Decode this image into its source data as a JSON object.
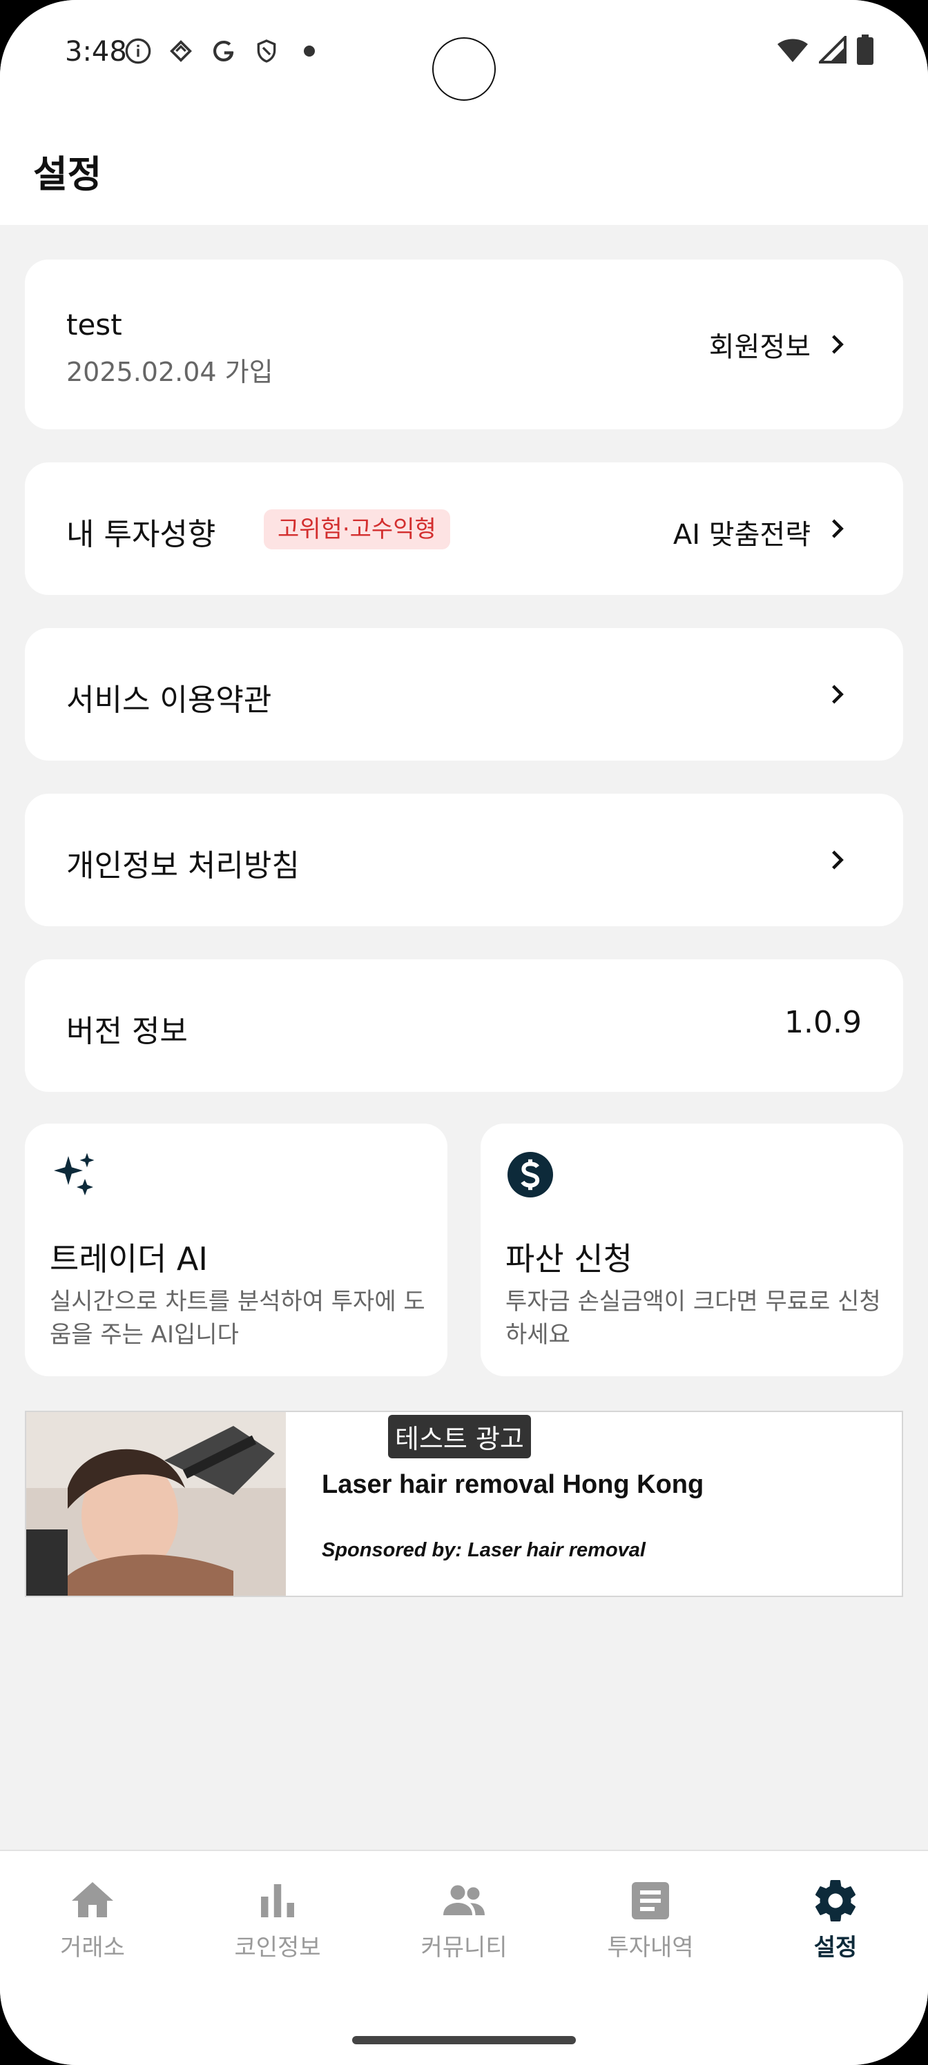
{
  "status_bar": {
    "time": "3:48",
    "left_icons": [
      "info-icon",
      "diamond-icon",
      "google-icon",
      "shield-icon",
      "dot-icon"
    ],
    "right_icons": [
      "wifi-icon",
      "signal-icon",
      "battery-icon"
    ]
  },
  "header": {
    "title": "설정"
  },
  "user": {
    "name": "test",
    "joined": "2025.02.04 가입",
    "member_info_label": "회원정보"
  },
  "investment": {
    "label": "내 투자성향",
    "badge": "고위험·고수익형",
    "ai_strategy_label": "AI 맞춤전략"
  },
  "menu": {
    "terms": "서비스 이용약관",
    "privacy": "개인정보 처리방침",
    "version_label": "버전 정보",
    "version_value": "1.0.9"
  },
  "features": [
    {
      "icon": "sparkles-icon",
      "title": "트레이더 AI",
      "description": "실시간으로 차트를 분석하여 투자에 도움을 주는 AI입니다"
    },
    {
      "icon": "dollar-circle-icon",
      "title": "파산 신청",
      "description": "투자금 손실금액이 크다면 무료로 신청하세요"
    }
  ],
  "ad": {
    "label": "테스트 광고",
    "title": "Laser hair removal Hong Kong",
    "sponsor": "Sponsored by: Laser hair removal"
  },
  "bottom_nav": [
    {
      "icon": "home-icon",
      "label": "거래소",
      "active": false
    },
    {
      "icon": "bar-chart-icon",
      "label": "코인정보",
      "active": false
    },
    {
      "icon": "people-icon",
      "label": "커뮤니티",
      "active": false
    },
    {
      "icon": "document-icon",
      "label": "투자내역",
      "active": false
    },
    {
      "icon": "gear-icon",
      "label": "설정",
      "active": true
    }
  ],
  "colors": {
    "accent": "#0d2a3a",
    "badge_bg": "#fde3e3",
    "badge_text": "#d32f2f",
    "background": "#f2f2f2"
  }
}
